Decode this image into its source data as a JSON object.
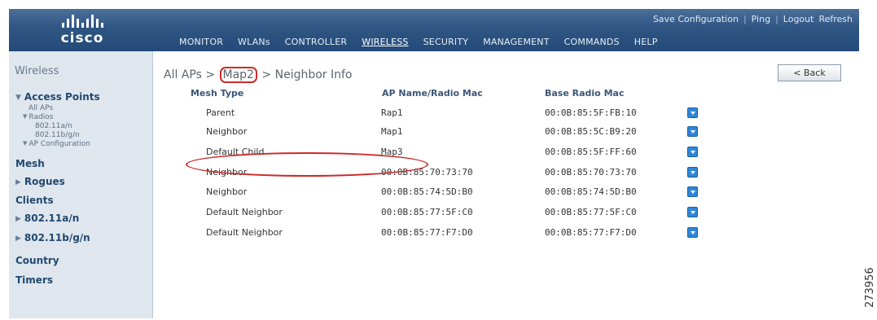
{
  "logo": {
    "word": "cisco"
  },
  "toplinks": {
    "save": "Save Configuration",
    "ping": "Ping",
    "logout": "Logout",
    "refresh": "Refresh",
    "separator": "|"
  },
  "nav": [
    "MONITOR",
    "WLANs",
    "CONTROLLER",
    "WIRELESS",
    "SECURITY",
    "MANAGEMENT",
    "COMMANDS",
    "HELP"
  ],
  "nav_active": "WIRELESS",
  "sidebar": {
    "title": "Wireless",
    "access_points": "Access Points",
    "all_aps": "All APs",
    "radios": "Radios",
    "radio_a": "802.11a/n",
    "radio_bg": "802.11b/g/n",
    "ap_config": "AP Configuration",
    "mesh": "Mesh",
    "rogues": "Rogues",
    "clients": "Clients",
    "b80211an": "802.11a/n",
    "b80211bgn": "802.11b/g/n",
    "country": "Country",
    "timers": "Timers"
  },
  "breadcrumb": {
    "part1": "All APs >",
    "part2": "Map2",
    "part3": "> Neighbor Info"
  },
  "back_label": "< Back",
  "table": {
    "headers": [
      "Mesh Type",
      "AP Name/Radio Mac",
      "Base Radio Mac"
    ],
    "rows": [
      [
        "Parent",
        "Rap1",
        "00:0B:85:5F:FB:10"
      ],
      [
        "Neighbor",
        "Map1",
        "00:0B:85:5C:B9:20"
      ],
      [
        "Default Child",
        "Map3",
        "00:0B:85:5F:FF:60"
      ],
      [
        "Neighbor",
        "00:0B:85:70:73:70",
        "00:0B:85:70:73:70"
      ],
      [
        "Neighbor",
        "00:0B:85:74:5D:B0",
        "00:0B:85:74:5D:B0"
      ],
      [
        "Default Neighbor",
        "00:0B:85:77:5F:C0",
        "00:0B:85:77:5F:C0"
      ],
      [
        "Default Neighbor",
        "00:0B:85:77:F7:D0",
        "00:0B:85:77:F7:D0"
      ]
    ]
  },
  "figure_id": "273956",
  "colors": {
    "header": "#2f5583",
    "sidebar": "#dfe6ee",
    "highlight": "#cc2a2a",
    "dropdown": "#2f86d8"
  }
}
